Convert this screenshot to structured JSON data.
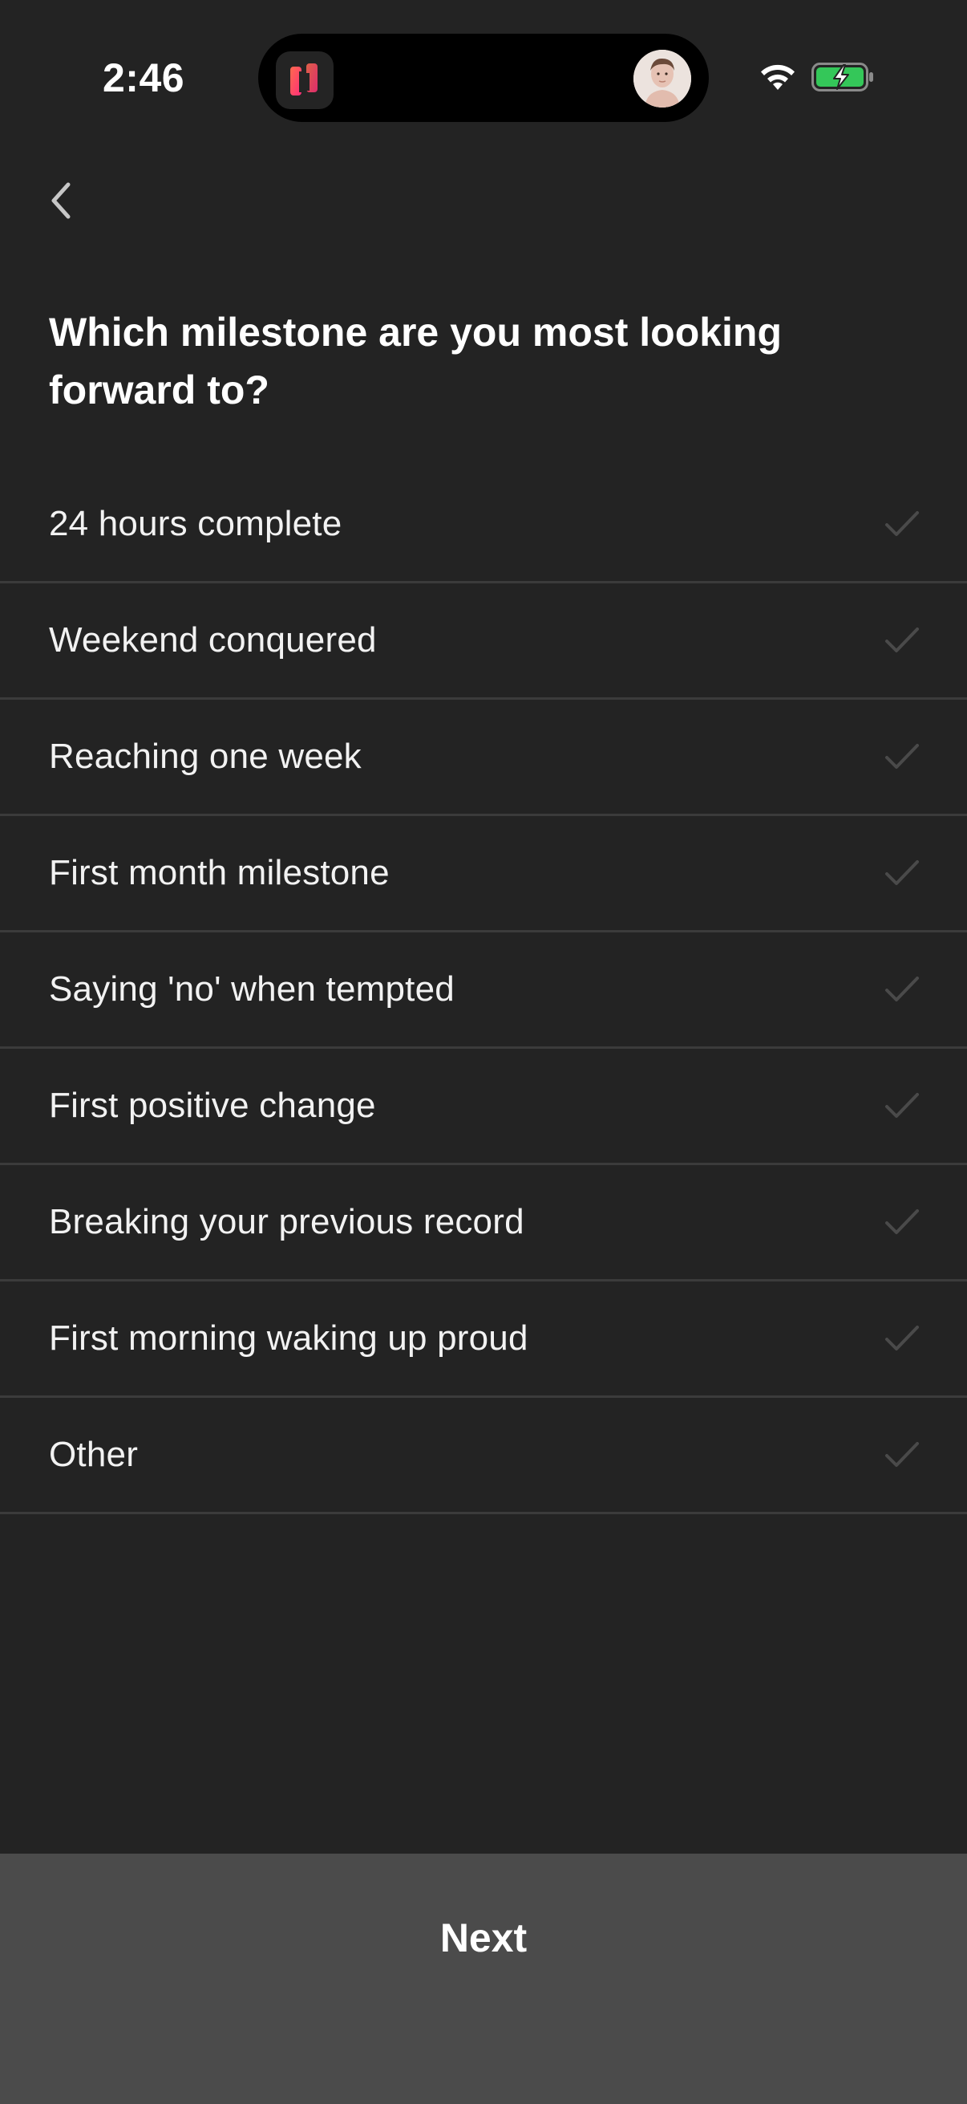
{
  "status_bar": {
    "time": "2:46",
    "icons": [
      "app-tile-icon",
      "avatar",
      "wifi-icon",
      "battery-charging-icon"
    ],
    "battery_color": "#34c759"
  },
  "nav": {
    "back_icon": "chevron-left-icon"
  },
  "question": {
    "title": "Which milestone are you most looking forward to?"
  },
  "options": [
    {
      "label": "24 hours complete"
    },
    {
      "label": "Weekend conquered"
    },
    {
      "label": "Reaching one week"
    },
    {
      "label": "First month milestone"
    },
    {
      "label": "Saying 'no' when tempted"
    },
    {
      "label": "First positive change"
    },
    {
      "label": "Breaking your previous record"
    },
    {
      "label": "First morning waking up proud"
    },
    {
      "label": "Other"
    }
  ],
  "footer": {
    "next_label": "Next"
  },
  "colors": {
    "background": "#232323",
    "divider": "#3b3b3b",
    "footer": "#4b4b4b",
    "check_inactive": "#4a4a4a",
    "app_accent": "#ff4f6e"
  }
}
